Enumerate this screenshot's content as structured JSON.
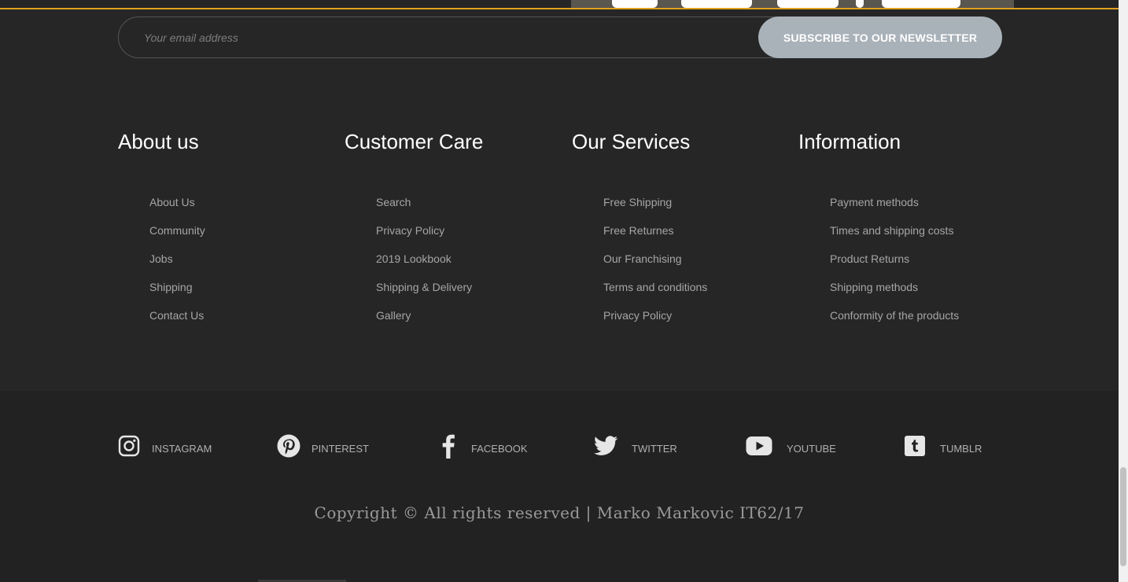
{
  "newsletter": {
    "email_placeholder": "Your email address",
    "subscribe_label": "SUBSCRIBE TO OUR NEWSLETTER"
  },
  "footer": {
    "columns": [
      {
        "title": "About us",
        "links": [
          "About Us",
          "Community",
          "Jobs",
          "Shipping",
          "Contact Us"
        ]
      },
      {
        "title": "Customer Care",
        "links": [
          "Search",
          "Privacy Policy",
          "2019 Lookbook",
          "Shipping & Delivery",
          "Gallery"
        ]
      },
      {
        "title": "Our Services",
        "links": [
          "Free Shipping",
          "Free Returnes",
          "Our Franchising",
          "Terms and conditions",
          "Privacy Policy"
        ]
      },
      {
        "title": "Information",
        "links": [
          "Payment methods",
          "Times and shipping costs",
          "Product Returns",
          "Shipping methods",
          "Conformity of the products"
        ]
      }
    ]
  },
  "social": [
    {
      "label": "INSTAGRAM",
      "icon": "instagram-icon"
    },
    {
      "label": "PINTEREST",
      "icon": "pinterest-icon"
    },
    {
      "label": "FACEBOOK",
      "icon": "facebook-icon"
    },
    {
      "label": "TWITTER",
      "icon": "twitter-icon"
    },
    {
      "label": "YOUTUBE",
      "icon": "youtube-icon"
    },
    {
      "label": "TUMBLR",
      "icon": "tumblr-icon"
    }
  ],
  "copyright": "Copyright © All rights reserved | Marko Markovic IT62/17",
  "colors": {
    "footer_bg": "#262626",
    "social_bg": "#222222",
    "accent": "#e0a020",
    "button_bg": "#a9b2b9"
  }
}
